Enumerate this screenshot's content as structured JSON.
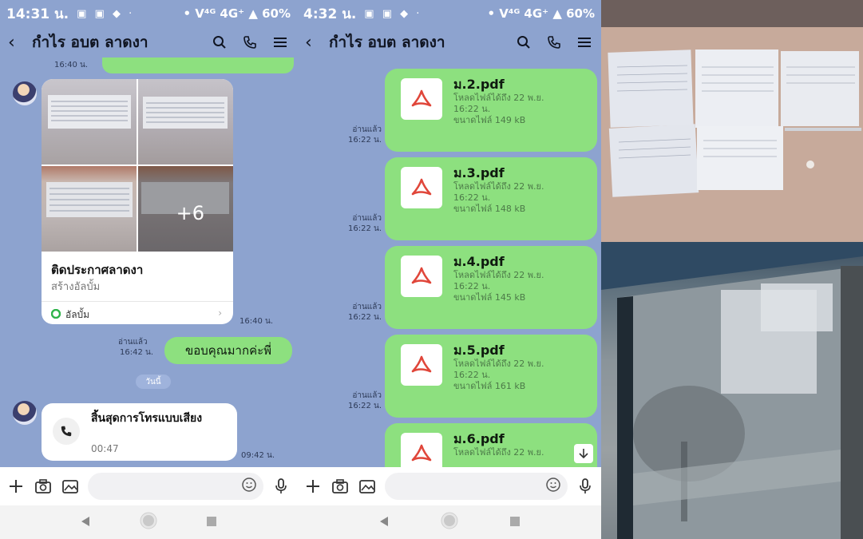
{
  "left_screen": {
    "status": {
      "time": "14:31 น.",
      "system": "• V⁴ᴳ 4G⁺ ▲ 60%"
    },
    "header": {
      "back": "‹",
      "title": "กำไร อบต ลาดงา"
    },
    "messages": {
      "top_time": "16:40 น.",
      "album": {
        "more_count": "+6",
        "title": "ติดประกาศลาดงา",
        "subtitle": "สร้างอัลบั้ม",
        "footer": "อัลบั้ม",
        "time": "16:40 น."
      },
      "thanks": {
        "read": "อ่านแล้ว",
        "time": "16:42 น.",
        "text": "ขอบคุณมากค่ะพี่"
      },
      "date_label": "วันนี้",
      "call": {
        "title": "สิ้นสุดการโทรแบบเสียง",
        "duration": "00:47",
        "time": "09:42 น."
      }
    }
  },
  "right_screen": {
    "status": {
      "time": "4:32 น.",
      "system": "• V⁴ᴳ 4G⁺ ▲ 60%"
    },
    "header": {
      "back": "‹",
      "title": "กำไร อบต ลาดงา"
    },
    "files": [
      {
        "name": "ม.2.pdf",
        "meta1": "โหลดไฟล์ได้ถึง 22 พ.ย.",
        "meta2": "16:22 น.",
        "size": "ขนาดไฟล์ 149 kB",
        "read": "อ่านแล้ว",
        "time": "16:22 น."
      },
      {
        "name": "ม.3.pdf",
        "meta1": "โหลดไฟล์ได้ถึง 22 พ.ย.",
        "meta2": "16:22 น.",
        "size": "ขนาดไฟล์ 148 kB",
        "read": "อ่านแล้ว",
        "time": "16:22 น."
      },
      {
        "name": "ม.4.pdf",
        "meta1": "โหลดไฟล์ได้ถึง 22 พ.ย.",
        "meta2": "16:22 น.",
        "size": "ขนาดไฟล์ 145 kB",
        "read": "อ่านแล้ว",
        "time": "16:22 น."
      },
      {
        "name": "ม.5.pdf",
        "meta1": "โหลดไฟล์ได้ถึง 22 พ.ย.",
        "meta2": "16:22 น.",
        "size": "ขนาดไฟล์ 161 kB",
        "read": "อ่านแล้ว",
        "time": "16:22 น."
      },
      {
        "name": "ม.6.pdf",
        "meta1": "โหลดไฟล์ได้ถึง 22 พ.ย."
      }
    ]
  },
  "icons": {
    "header": [
      "search-icon",
      "phone-icon",
      "menu-icon"
    ],
    "composer": [
      "plus-icon",
      "camera-icon",
      "image-icon",
      "emoji-icon",
      "mic-icon"
    ],
    "navbar": [
      "back-nav-icon",
      "home-nav-icon",
      "recents-nav-icon"
    ],
    "file": "pdf-icon"
  },
  "colors": {
    "chat_background": "#8da3cf",
    "bubble_green": "#8de07f",
    "pdf_red": "#e0463a",
    "album_dot": "#2fb34a"
  }
}
